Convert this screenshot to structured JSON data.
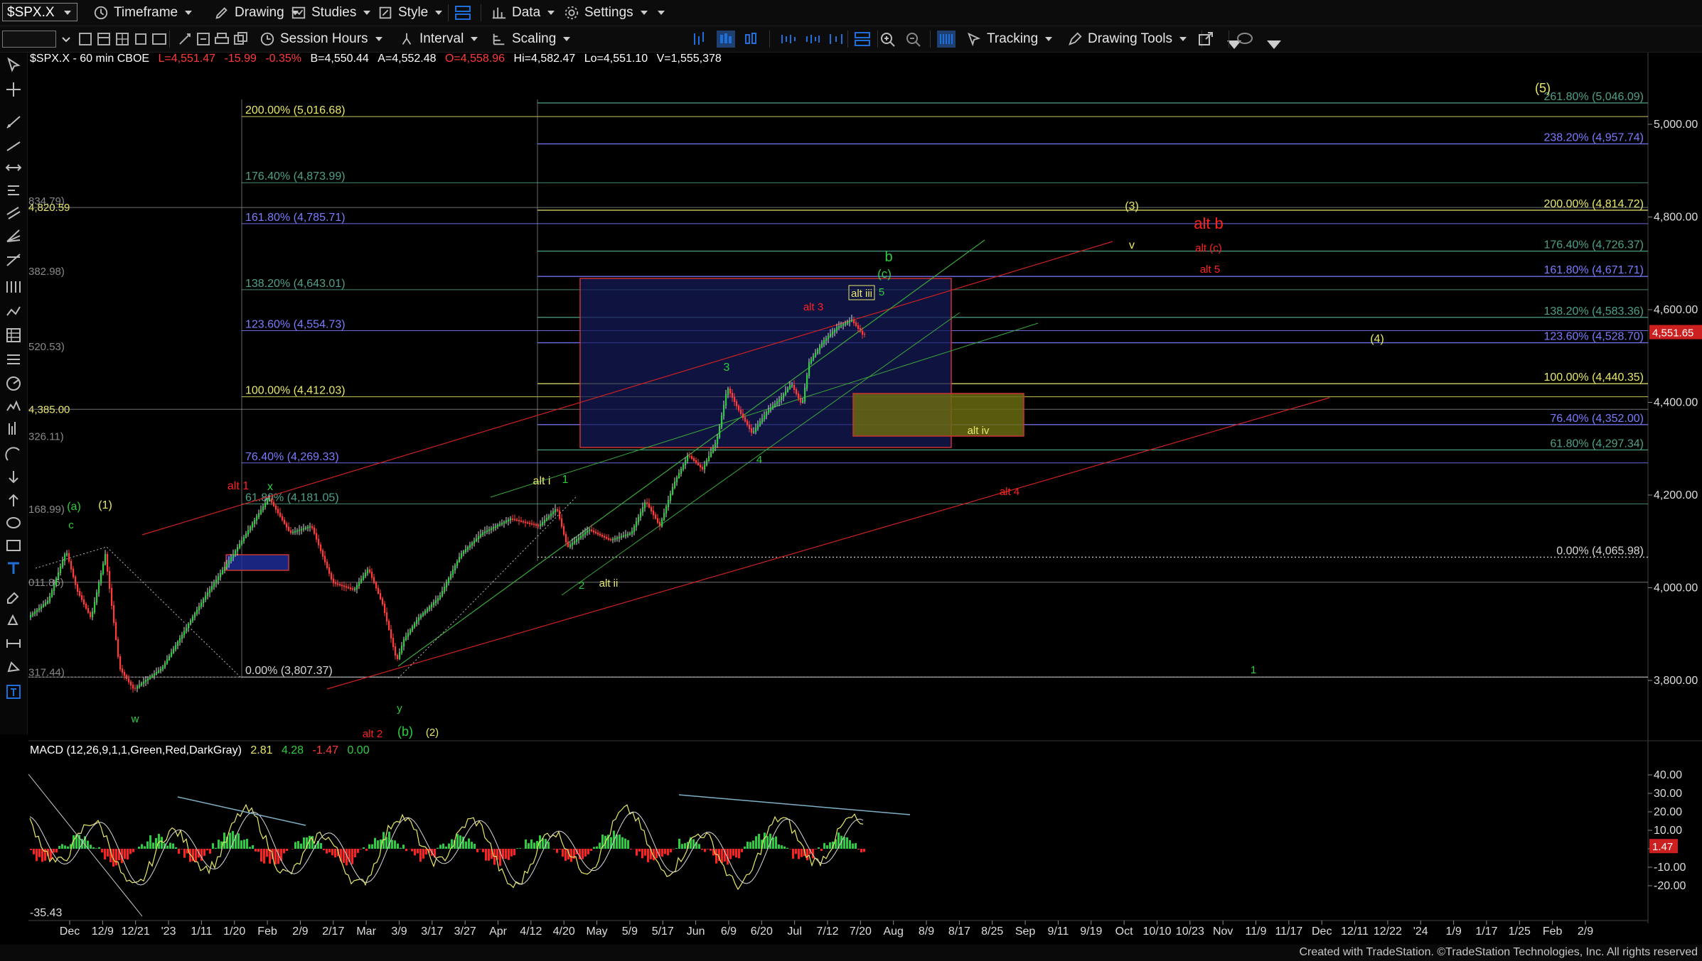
{
  "toolbar": {
    "symbol": "$SPX.X",
    "timeframe": "Timeframe",
    "drawing": "Drawing",
    "studies": "Studies",
    "style": "Style",
    "data": "Data",
    "settings": "Settings",
    "session_hours": "Session Hours",
    "interval": "Interval",
    "scaling": "Scaling",
    "tracking": "Tracking",
    "drawing_tools": "Drawing Tools"
  },
  "legend": {
    "symbol": "$SPX.X - 60 min CBOE",
    "last": "L=4,551.47",
    "change": "-15.99",
    "change_pct": "-0.35%",
    "bid": "B=4,550.44",
    "ask": "A=4,552.48",
    "open": "O=4,558.96",
    "high": "Hi=4,582.47",
    "low": "Lo=4,551.10",
    "volume": "V=1,555,378"
  },
  "macd_legend": {
    "name": "MACD (12,26,9,1,1,Green,Red,DarkGray)",
    "v1": "2.81",
    "v2": "4.28",
    "v3": "-1.47",
    "v4": "0.00"
  },
  "footer": "Created with TradeStation. ©TradeStation Technologies, Inc. All rights reserved",
  "price_axis": {
    "ticks": [
      "5,000.00",
      "4,800.00",
      "4,600.00",
      "4,400.00",
      "4,200.00",
      "4,000.00",
      "3,800.00"
    ],
    "current": "4,551.65"
  },
  "macd_axis": {
    "ticks": [
      "40.00",
      "30.00",
      "20.00",
      "10.00",
      "0.00",
      "-10.00",
      "-20.00"
    ],
    "current": "1.47",
    "min_label": "-35.43"
  },
  "time_axis": [
    "Dec",
    "12/9",
    "12/21",
    "'23",
    "1/11",
    "1/20",
    "Feb",
    "2/9",
    "2/17",
    "Mar",
    "3/9",
    "3/17",
    "3/27",
    "Apr",
    "4/12",
    "4/20",
    "May",
    "5/9",
    "5/17",
    "Jun",
    "6/9",
    "6/20",
    "Jul",
    "7/12",
    "7/20",
    "Aug",
    "8/9",
    "8/17",
    "8/25",
    "Sep",
    "9/11",
    "9/19",
    "Oct",
    "10/10",
    "10/23",
    "Nov",
    "11/9",
    "11/17",
    "Dec",
    "12/11",
    "12/22",
    "'24",
    "1/9",
    "1/17",
    "1/25",
    "Feb",
    "2/9"
  ],
  "fib_left": [
    {
      "label": "200.00% (5,016.68)",
      "color": "#e8e86a"
    },
    {
      "label": "176.40% (4,873.99)",
      "color": "#4fa08a"
    },
    {
      "label": "161.80% (4,785.71)",
      "color": "#7b7bff"
    },
    {
      "label": "138.20% (4,643.01)",
      "color": "#4fa08a"
    },
    {
      "label": "123.60% (4,554.73)",
      "color": "#7b7bff"
    },
    {
      "label": "100.00% (4,412.03)",
      "color": "#e8e86a"
    },
    {
      "label": "76.40% (4,269.33)",
      "color": "#7b7bff"
    },
    {
      "label": "61.80% (4,181.05)",
      "color": "#4fa08a"
    },
    {
      "label": "0.00% (3,807.37)",
      "color": "#d8d8d8"
    }
  ],
  "fib_right": [
    {
      "label": "261.80% (5,046.09)",
      "color": "#4fa08a"
    },
    {
      "label": "238.20% (4,957.74)",
      "color": "#7b7bff"
    },
    {
      "label": "200.00% (4,814.72)",
      "color": "#e8e86a"
    },
    {
      "label": "176.40% (4,726.37)",
      "color": "#4fa08a"
    },
    {
      "label": "161.80% (4,671.71)",
      "color": "#7b7bff"
    },
    {
      "label": "138.20% (4,583.36)",
      "color": "#4fa08a"
    },
    {
      "label": "123.60% (4,528.70)",
      "color": "#7b7bff"
    },
    {
      "label": "100.00% (4,440.35)",
      "color": "#e8e86a"
    },
    {
      "label": "76.40% (4,352.00)",
      "color": "#7b7bff"
    },
    {
      "label": "61.80% (4,297.34)",
      "color": "#4fa08a"
    },
    {
      "label": "0.00% (4,065.98)",
      "color": "#d8d8d8"
    }
  ],
  "left_edge_labels": [
    "834.79)",
    "4,820.59",
    "382.98)",
    "520.53)",
    "4,385.00",
    "326.11)",
    "168.99)",
    "011.86)",
    "317.44)"
  ],
  "wave_labels": [
    {
      "t": "(5)",
      "c": "#e8e86a"
    },
    {
      "t": "(3)",
      "c": "#e8e86a"
    },
    {
      "t": "alt b",
      "c": "#ff2020"
    },
    {
      "t": "v",
      "c": "#e8e86a"
    },
    {
      "t": "alt (c)",
      "c": "#ff2020"
    },
    {
      "t": "alt 5",
      "c": "#ff2020"
    },
    {
      "t": "b",
      "c": "#2ecc40"
    },
    {
      "t": "(c)",
      "c": "#2ecc40"
    },
    {
      "t": "alt iii",
      "c": "#e8e86a"
    },
    {
      "t": "5",
      "c": "#2ecc40"
    },
    {
      "t": "alt 3",
      "c": "#ff2020"
    },
    {
      "t": "(4)",
      "c": "#e8e86a"
    },
    {
      "t": "3",
      "c": "#2ecc40"
    },
    {
      "t": "alt iv",
      "c": "#e8e86a"
    },
    {
      "t": "4",
      "c": "#2ecc40"
    },
    {
      "t": "alt 4",
      "c": "#ff2020"
    },
    {
      "t": "alt i",
      "c": "#e8e86a"
    },
    {
      "t": "1",
      "c": "#2ecc40"
    },
    {
      "t": "alt 1",
      "c": "#ff2020"
    },
    {
      "t": "x",
      "c": "#2ecc40"
    },
    {
      "t": "(a)",
      "c": "#2ecc40"
    },
    {
      "t": "(1)",
      "c": "#e8e86a"
    },
    {
      "t": "c",
      "c": "#2ecc40"
    },
    {
      "t": "2",
      "c": "#2ecc40"
    },
    {
      "t": "alt ii",
      "c": "#e8e86a"
    },
    {
      "t": "1",
      "c": "#2ecc40"
    },
    {
      "t": "w",
      "c": "#2ecc40"
    },
    {
      "t": "y",
      "c": "#2ecc40"
    },
    {
      "t": "alt 2",
      "c": "#ff2020"
    },
    {
      "t": "(b)",
      "c": "#2ecc40"
    },
    {
      "t": "(2)",
      "c": "#e8e86a"
    }
  ],
  "colors": {
    "background": "#000000",
    "up": "#2ecc40",
    "down": "#ff3b3b",
    "accent": "#1e6fd9"
  }
}
